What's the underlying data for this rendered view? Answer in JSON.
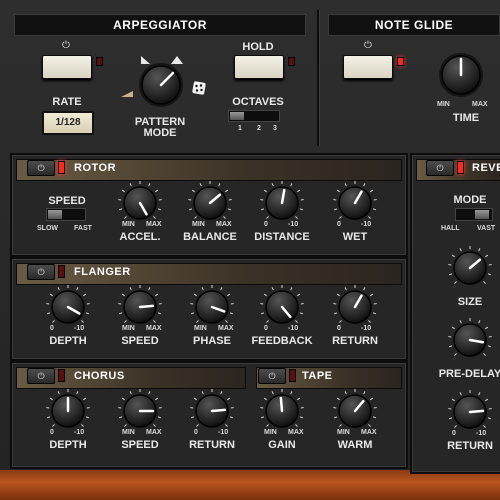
{
  "arpeggiator": {
    "title": "ARPEGGIATOR",
    "power_symbol": "⏻",
    "power_on": false,
    "rate_label": "RATE",
    "rate_value": "1/128",
    "pattern_label_1": "PATTERN",
    "pattern_label_2": "MODE",
    "hold_label": "HOLD",
    "octaves_label": "OCTAVES",
    "octave_ticks": [
      "1",
      "2",
      "3"
    ]
  },
  "note_glide": {
    "title": "NOTE GLIDE",
    "power_on": true,
    "min": "MIN",
    "max": "MAX",
    "time_label": "TIME"
  },
  "rotor": {
    "title": "ROTOR",
    "speed_label": "SPEED",
    "slow": "SLOW",
    "fast": "FAST",
    "knobs": [
      {
        "label": "ACCEL.",
        "min": "MIN",
        "max": "MAX"
      },
      {
        "label": "BALANCE",
        "min": "MIN",
        "max": "MAX"
      },
      {
        "label": "DISTANCE",
        "min": "0",
        "max": "-10"
      },
      {
        "label": "WET",
        "min": "0",
        "max": "-10"
      }
    ]
  },
  "reverb": {
    "title": "REVE",
    "mode_label": "MODE",
    "hall": "HALL",
    "vast": "VAST",
    "knobs": [
      {
        "label": "SIZE",
        "min": "",
        "max": ""
      },
      {
        "label": "PRE-DELAY",
        "min": "",
        "max": ""
      },
      {
        "label": "RETURN",
        "min": "0",
        "max": "-10"
      }
    ]
  },
  "flanger": {
    "title": "FLANGER",
    "knobs": [
      {
        "label": "DEPTH",
        "min": "0",
        "max": "-10"
      },
      {
        "label": "SPEED",
        "min": "MIN",
        "max": "MAX"
      },
      {
        "label": "PHASE",
        "min": "MIN",
        "max": "MAX"
      },
      {
        "label": "FEEDBACK",
        "min": "0",
        "max": "-10"
      },
      {
        "label": "RETURN",
        "min": "0",
        "max": "-10"
      }
    ]
  },
  "chorus": {
    "title": "CHORUS",
    "knobs": [
      {
        "label": "DEPTH",
        "min": "0",
        "max": "-10"
      },
      {
        "label": "SPEED",
        "min": "MIN",
        "max": "MAX"
      },
      {
        "label": "RETURN",
        "min": "0",
        "max": "-10"
      }
    ]
  },
  "tape": {
    "title": "TAPE",
    "knobs": [
      {
        "label": "GAIN",
        "min": "MIN",
        "max": "MAX"
      },
      {
        "label": "WARM",
        "min": "MIN",
        "max": "MAX"
      }
    ]
  },
  "colors": {
    "led_on": "#ff2a1a",
    "cream_button": "#efeadb",
    "wood": "#b7551e"
  }
}
